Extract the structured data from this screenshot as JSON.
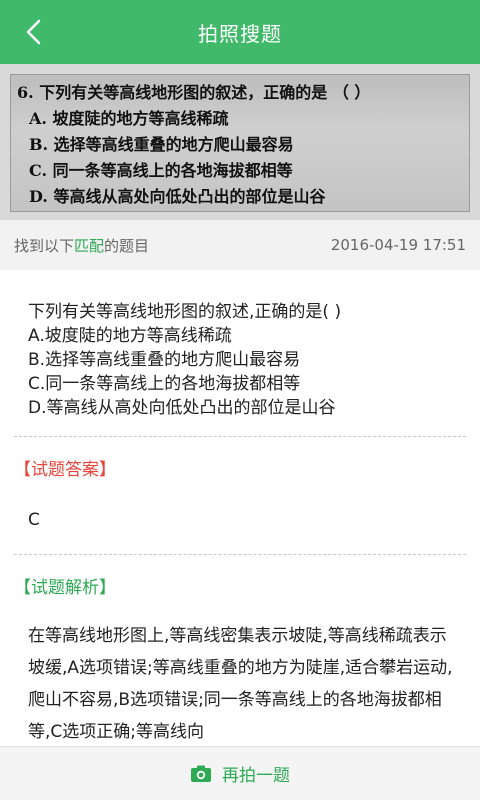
{
  "header": {
    "title": "拍照搜题",
    "back_icon": "chevron-left-icon"
  },
  "photo": {
    "lines": [
      "6. 下列有关等高线地形图的叙述，正确的是 （  ）",
      "A. 坡度陡的地方等高线稀疏",
      "B. 选择等高线重叠的地方爬山最容易",
      "C. 同一条等高线上的各地海拔都相等",
      "D. 等高线从高处向低处凸出的部位是山谷"
    ]
  },
  "match": {
    "prefix": "找到以下",
    "highlight": "匹配",
    "suffix": "的题目",
    "timestamp": "2016-04-19 17:51"
  },
  "question": {
    "stem": "下列有关等高线地形图的叙述,正确的是( )",
    "options": [
      "A.坡度陡的地方等高线稀疏",
      "B.选择等高线重叠的地方爬山最容易",
      "C.同一条等高线上的各地海拔都相等",
      "D.等高线从高处向低处凸出的部位是山谷"
    ]
  },
  "answer": {
    "label": "【试题答案】",
    "value": "C"
  },
  "explanation": {
    "label": "【试题解析】",
    "text": "在等高线地形图上,等高线密集表示坡陡,等高线稀疏表示坡缓,A选项错误;等高线重叠的地方为陡崖,适合攀岩运动,爬山不容易,B选项错误;同一条等高线上的各地海拔都相等,C选项正确;等高线向"
  },
  "bottom": {
    "retake_label": "再拍一题",
    "camera_icon": "camera-icon"
  },
  "colors": {
    "brand_green": "#41b96b",
    "accent_green": "#2eaa55",
    "answer_red": "#e8463c"
  }
}
